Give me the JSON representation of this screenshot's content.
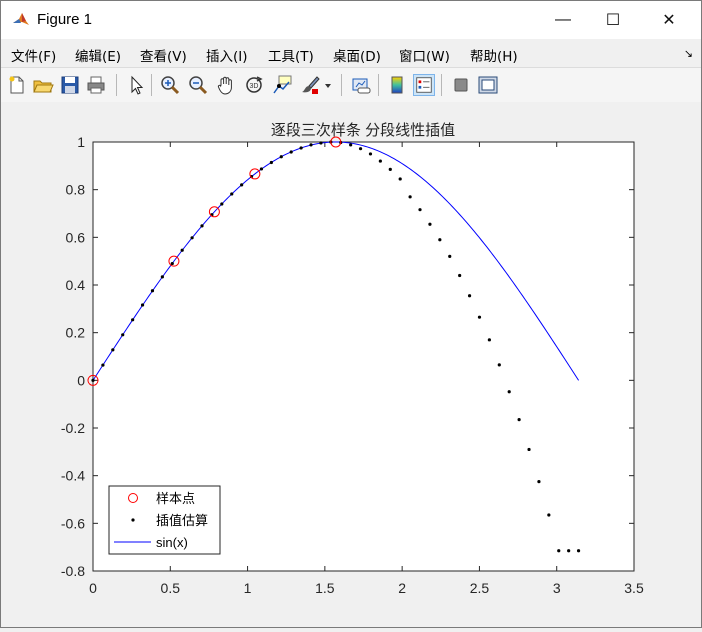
{
  "window": {
    "title": "Figure 1",
    "minimize_glyph": "—",
    "maximize_glyph": "☐",
    "close_glyph": "✕",
    "icon": "matlab-logo-icon"
  },
  "menubar": {
    "items": [
      {
        "label": "文件(F)"
      },
      {
        "label": "编辑(E)"
      },
      {
        "label": "查看(V)"
      },
      {
        "label": "插入(I)"
      },
      {
        "label": "工具(T)"
      },
      {
        "label": "桌面(D)"
      },
      {
        "label": "窗口(W)"
      },
      {
        "label": "帮助(H)"
      }
    ],
    "dock_arrow_glyph": "↘"
  },
  "toolbar": {
    "icons": [
      "new-figure-icon",
      "open-file-icon",
      "save-icon",
      "print-icon",
      "select-arrow-icon",
      "zoom-in-icon",
      "zoom-out-icon",
      "pan-hand-icon",
      "rotate-3d-icon",
      "data-cursor-icon",
      "brush-icon",
      "brush-dropdown-icon",
      "link-plot-icon",
      "colorbar-icon",
      "legend-icon",
      "hide-plot-tools-icon",
      "show-plot-tools-icon"
    ]
  },
  "chart_data": {
    "type": "line",
    "title": "逐段三次样条  分段线性插值",
    "xlabel": "",
    "ylabel": "",
    "xlim": [
      0,
      3.5
    ],
    "ylim": [
      -0.8,
      1
    ],
    "xticks": [
      "0",
      "0.5",
      "1",
      "1.5",
      "2",
      "2.5",
      "3",
      "3.5"
    ],
    "yticks": [
      "-0.8",
      "-0.6",
      "-0.4",
      "-0.2",
      "0",
      "0.2",
      "0.4",
      "0.6",
      "0.8",
      "1"
    ],
    "grid": false,
    "legend_placement": "bottom-left",
    "series": [
      {
        "name": "样本点",
        "style": "red-circles",
        "color": "#ff0000",
        "x": [
          0,
          0.5236,
          0.7854,
          1.0472,
          1.5708
        ],
        "y": [
          0,
          0.5,
          0.7071,
          0.866,
          1.0
        ]
      },
      {
        "name": "插值估算",
        "style": "black-dots",
        "color": "#000000",
        "x": [
          0,
          0.0641,
          0.1282,
          0.1923,
          0.2565,
          0.3206,
          0.3847,
          0.4488,
          0.5129,
          0.577,
          0.6411,
          0.7052,
          0.7693,
          0.8334,
          0.8976,
          0.9617,
          1.0258,
          1.0899,
          1.154,
          1.2181,
          1.2822,
          1.3463,
          1.4104,
          1.4745,
          1.5387,
          1.6028,
          1.6669,
          1.731,
          1.7951,
          1.8592,
          1.9233,
          1.9874,
          2.0515,
          2.1156,
          2.1798,
          2.2439,
          2.308,
          2.3721,
          2.4362,
          2.5003,
          2.5644,
          2.6285,
          2.6926,
          2.7567,
          2.8209,
          2.885,
          2.9491,
          3.0132,
          3.0773,
          3.1414
        ],
        "y": [
          0,
          0.064,
          0.128,
          0.191,
          0.254,
          0.316,
          0.376,
          0.434,
          0.49,
          0.546,
          0.598,
          0.648,
          0.695,
          0.74,
          0.782,
          0.82,
          0.855,
          0.887,
          0.914,
          0.938,
          0.958,
          0.975,
          0.988,
          0.996,
          1.0,
          0.998,
          0.988,
          0.972,
          0.95,
          0.92,
          0.885,
          0.845,
          0.77,
          0.716,
          0.655,
          0.59,
          0.52,
          0.44,
          0.355,
          0.265,
          0.17,
          0.065,
          -0.048,
          -0.165,
          -0.29,
          -0.425,
          -0.565,
          -0.715,
          -0.715,
          -0.715
        ]
      },
      {
        "name": "sin(x)",
        "style": "blue-line",
        "color": "#0000ff",
        "function": "sin",
        "x_range": [
          0,
          3.1416
        ]
      }
    ]
  }
}
